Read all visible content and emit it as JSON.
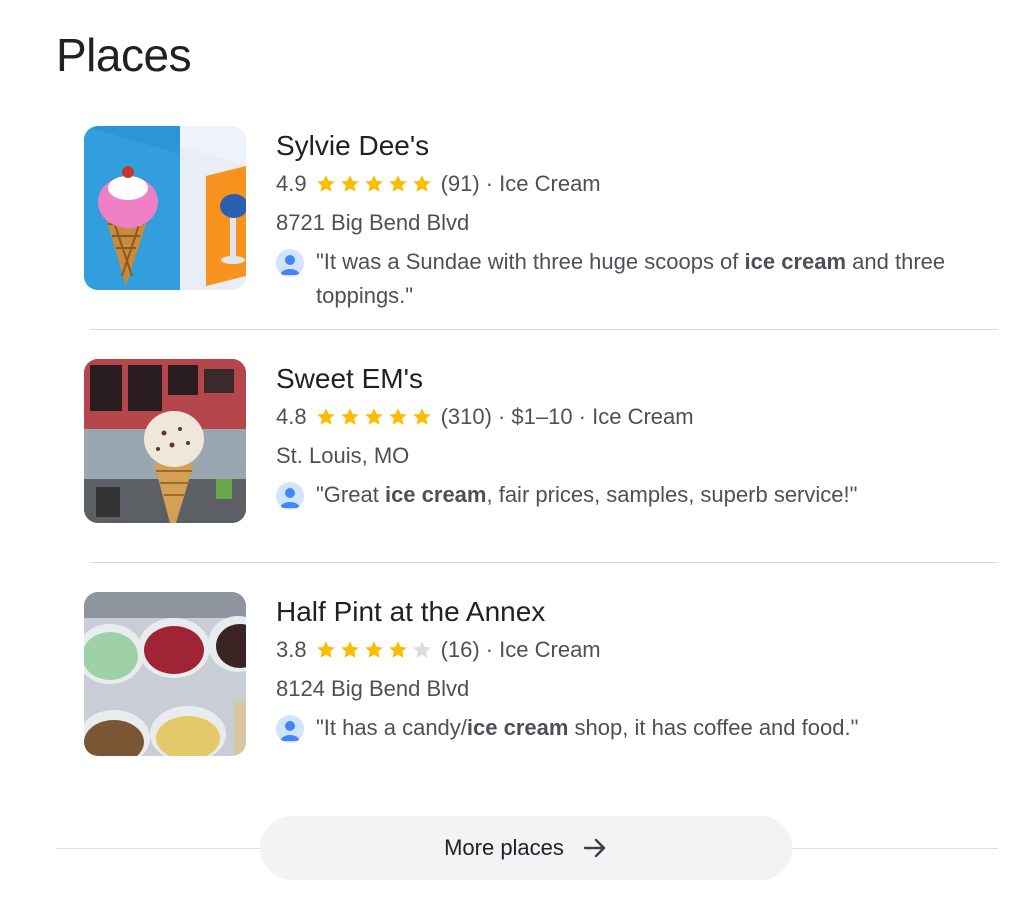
{
  "section": {
    "title": "Places"
  },
  "places": [
    {
      "name": "Sylvie Dee's",
      "rating": "4.9",
      "stars": 5,
      "review_count": "(91)",
      "details": "· Ice Cream",
      "address": "8721 Big Bend Blvd",
      "review": {
        "before": "\"It was a Sundae with three huge scoops of ",
        "bold": "ice cream",
        "after": " and three toppings.\""
      },
      "image": "ice-cream-cone-painting-icon"
    },
    {
      "name": "Sweet EM's",
      "rating": "4.8",
      "stars": 5,
      "review_count": "(310)",
      "details": "· $1–10 · Ice Cream",
      "address": "St. Louis, MO",
      "review": {
        "before": "\"Great ",
        "bold": "ice cream",
        "after": ", fair prices, samples, superb service!\""
      },
      "image": "ice-cream-cone-photo-icon"
    },
    {
      "name": "Half Pint at the Annex",
      "rating": "3.8",
      "stars": 4,
      "review_count": "(16)",
      "details": "· Ice Cream",
      "address": "8124 Big Bend Blvd",
      "review": {
        "before": "\"It has a candy/",
        "bold": "ice cream",
        "after": " shop, it has coffee and food.\""
      },
      "image": "ice-cream-tubs-photo-icon"
    }
  ],
  "more_button": {
    "label": "More places",
    "icon": "arrow-right-icon"
  },
  "colors": {
    "star_filled": "#fbbc04",
    "star_empty": "#dadce0",
    "avatar_bg": "#d2e3fc",
    "avatar_fg": "#4285f4",
    "button_bg": "#f1f3f4"
  }
}
